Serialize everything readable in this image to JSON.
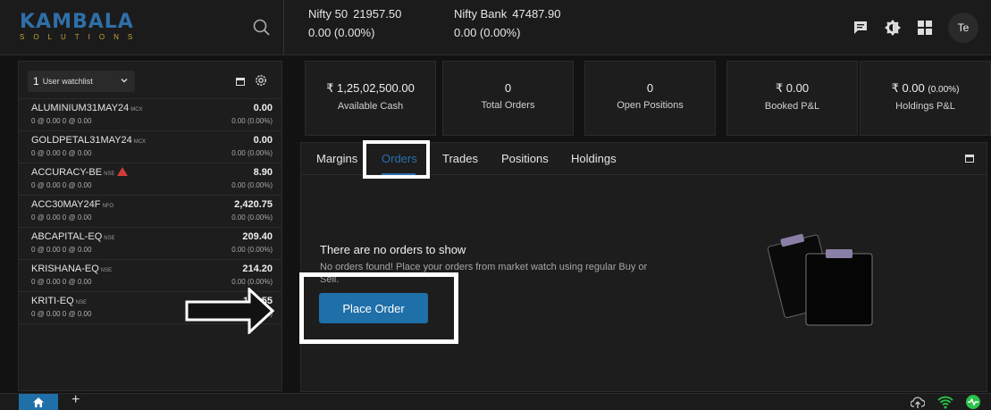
{
  "brand": {
    "name": "KAMBALA",
    "tagline": "SOLUTIONS"
  },
  "tickers": [
    {
      "name": "Nifty 50",
      "value": "21957.50",
      "change": "0.00 (0.00%)"
    },
    {
      "name": "Nifty Bank",
      "value": "47487.90",
      "change": "0.00 (0.00%)"
    }
  ],
  "user": {
    "initials": "Te"
  },
  "watchlist": {
    "number": "1",
    "label": "User watchlist",
    "items": [
      {
        "symbol": "ALUMINIUM31MAY24",
        "exchange": "MCX",
        "bidask": "0 @ 0.00   0 @ 0.00",
        "ltp": "0.00",
        "change": "0.00 (0.00%)",
        "warning": false
      },
      {
        "symbol": "GOLDPETAL31MAY24",
        "exchange": "MCX",
        "bidask": "0 @ 0.00   0 @ 0.00",
        "ltp": "0.00",
        "change": "0.00 (0.00%)",
        "warning": false
      },
      {
        "symbol": "ACCURACY-BE",
        "exchange": "NSE",
        "bidask": "0 @ 0.00   0 @ 0.00",
        "ltp": "8.90",
        "change": "0.00 (0.00%)",
        "warning": true
      },
      {
        "symbol": "ACC30MAY24F",
        "exchange": "NFO",
        "bidask": "0 @ 0.00   0 @ 0.00",
        "ltp": "2,420.75",
        "change": "0.00 (0.00%)",
        "warning": false
      },
      {
        "symbol": "ABCAPITAL-EQ",
        "exchange": "NSE",
        "bidask": "0 @ 0.00   0 @ 0.00",
        "ltp": "209.40",
        "change": "0.00 (0.00%)",
        "warning": false
      },
      {
        "symbol": "KRISHANA-EQ",
        "exchange": "NSE",
        "bidask": "0 @ 0.00   0 @ 0.00",
        "ltp": "214.20",
        "change": "0.00 (0.00%)",
        "warning": false
      },
      {
        "symbol": "KRITI-EQ",
        "exchange": "NSE",
        "bidask": "0 @ 0.00   0 @ 0.00",
        "ltp": "119.55",
        "change": "0.00 (0.00%)",
        "warning": false
      }
    ]
  },
  "summary": [
    {
      "value": "₹ 1,25,02,500.00",
      "caption": "Available Cash"
    },
    {
      "value": "0",
      "caption": "Total Orders"
    },
    {
      "value": "0",
      "caption": "Open Positions"
    },
    {
      "value": "₹ 0.00",
      "caption": "Booked P&L"
    },
    {
      "value": "₹ 0.00",
      "value_pct": "(0.00%)",
      "caption": "Holdings P&L"
    }
  ],
  "tabs": [
    "Margins",
    "Orders",
    "Trades",
    "Positions",
    "Holdings"
  ],
  "active_tab": "Orders",
  "empty_state": {
    "title": "There are no orders to show",
    "description": "No orders found! Place your orders from market watch using regular Buy or Sell.",
    "button": "Place Order"
  },
  "colors": {
    "accent": "#1f6fa8",
    "background": "#121212",
    "panel": "#1d1d1d",
    "warning": "#d23b3b",
    "online": "#29c24a"
  }
}
